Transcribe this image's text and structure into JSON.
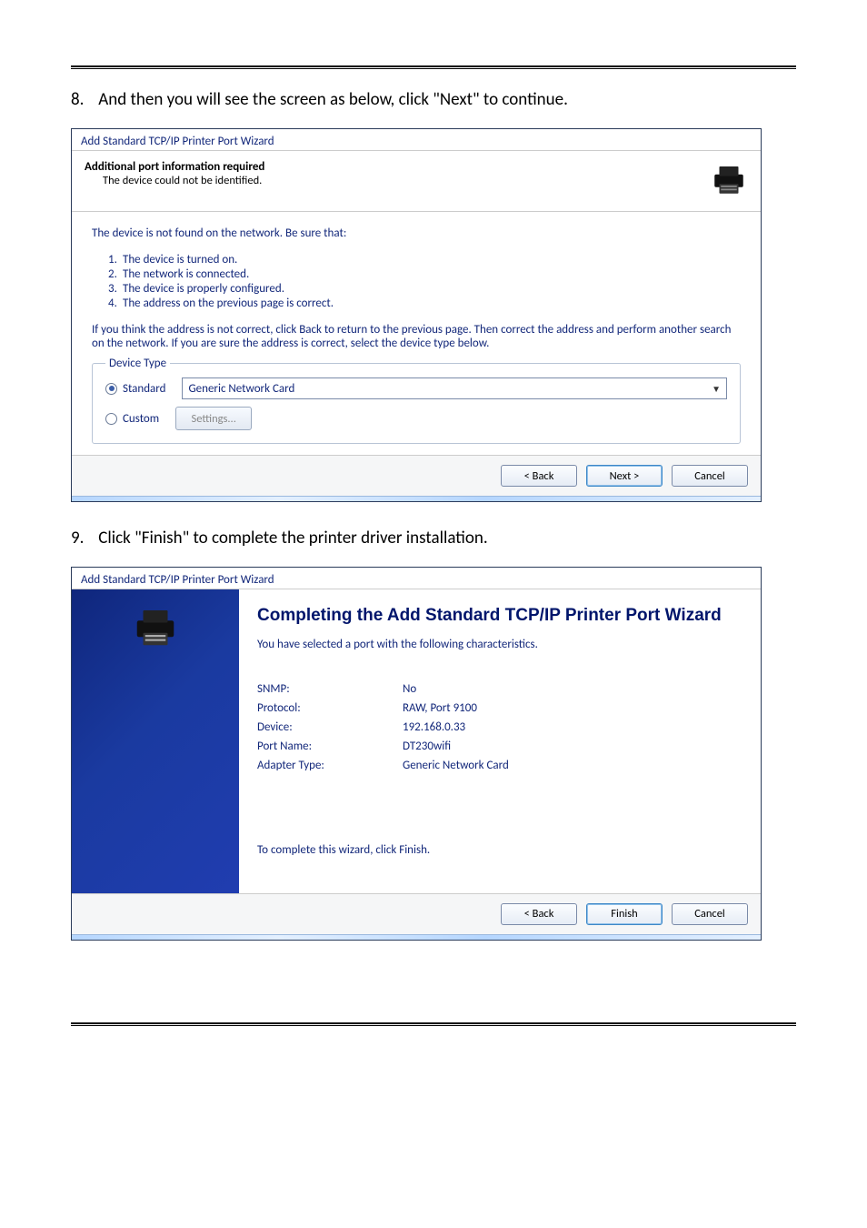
{
  "instructions": {
    "step8_num": "8.",
    "step8_text": "And then you will see the screen as below, click \"Next\" to continue.",
    "step9_num": "9.",
    "step9_text": "Click \"Finish\" to complete the printer driver installation."
  },
  "dialog1": {
    "title": "Add Standard TCP/IP Printer Port Wizard",
    "header_title": "Additional port information required",
    "header_sub": "The device could not be identified.",
    "para1": "The device is not found on the network.  Be sure that:",
    "list": {
      "i1n": "1.",
      "i1": "The device is turned on.",
      "i2n": "2.",
      "i2": "The network is connected.",
      "i3n": "3.",
      "i3": "The device is properly configured.",
      "i4n": "4.",
      "i4": "The address on the previous page is correct."
    },
    "para2": "If you think the address is not correct, click Back to return to the previous page.  Then correct the address and perform another search on the network.  If you are sure the address is correct, select the device type below.",
    "group_legend": "Device Type",
    "radio_standard": "Standard",
    "radio_custom": "Custom",
    "combo_value": "Generic Network Card",
    "settings_button": "Settings...",
    "back": "< Back",
    "next": "Next >",
    "cancel": "Cancel"
  },
  "dialog2": {
    "title": "Add Standard TCP/IP Printer Port Wizard",
    "heading": "Completing the Add Standard TCP/IP Printer Port Wizard",
    "sub": "You have selected a port with the following characteristics.",
    "kv": {
      "k1": "SNMP:",
      "v1": "No",
      "k2": "Protocol:",
      "v2": "RAW, Port 9100",
      "k3": "Device:",
      "v3": "192.168.0.33",
      "k4": "Port Name:",
      "v4": "DT230wifi",
      "k5": "Adapter Type:",
      "v5": "Generic Network Card"
    },
    "foot": "To complete this wizard, click Finish.",
    "back": "< Back",
    "finish": "Finish",
    "cancel": "Cancel"
  }
}
